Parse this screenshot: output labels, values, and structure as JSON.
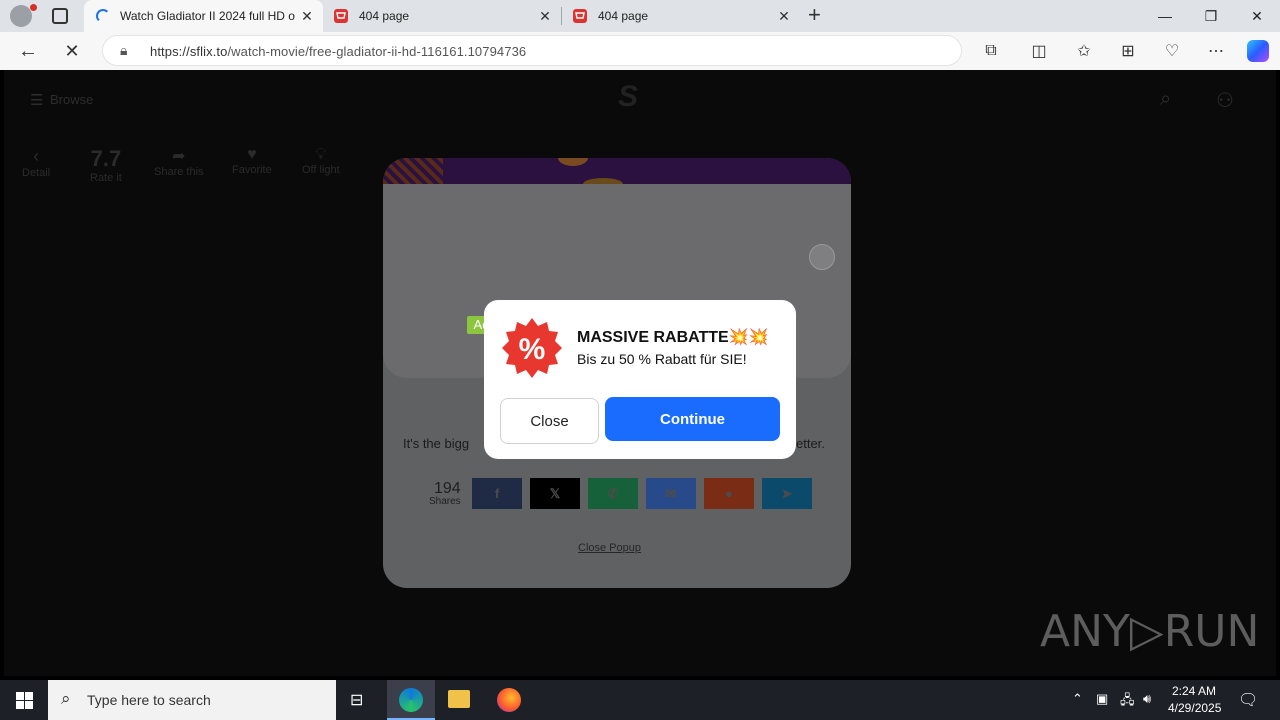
{
  "browser": {
    "tabs": [
      {
        "title": "Watch Gladiator II 2024 full HD on",
        "active": true
      },
      {
        "title": "404 page",
        "active": false
      },
      {
        "title": "404 page",
        "active": false
      }
    ],
    "url_host": "https://sflix.to",
    "url_path": "/watch-movie/free-gladiator-ii-hd-116161.10794736"
  },
  "site": {
    "browse_label": "Browse",
    "rating": "7.7",
    "actions": [
      {
        "label": "Detail"
      },
      {
        "label": "Rate it"
      },
      {
        "label": "Share this"
      },
      {
        "label": "Favorite"
      },
      {
        "label": "Off light"
      }
    ]
  },
  "site_popup": {
    "text_left": "It's the bigg",
    "text_right": "etter.",
    "share_count": "194",
    "share_word": "Shares",
    "share_buttons": [
      {
        "name": "facebook",
        "glyph": "f",
        "color": "#3b5998"
      },
      {
        "name": "x",
        "glyph": "𝕏",
        "color": "#000000"
      },
      {
        "name": "whatsapp",
        "glyph": "✆",
        "color": "#25d366"
      },
      {
        "name": "messenger",
        "glyph": "✉",
        "color": "#448aff"
      },
      {
        "name": "reddit",
        "glyph": "●",
        "color": "#ff4500"
      },
      {
        "name": "telegram",
        "glyph": "➤",
        "color": "#0088cc"
      }
    ],
    "close_label": "Close Popup"
  },
  "ad": {
    "badge": "Ad",
    "title": "MASSIVE RABATTE💥💥",
    "subtitle": "Bis zu 50 % Rabatt für SIE!",
    "close_label": "Close",
    "continue_label": "Continue",
    "icon_symbol": "%"
  },
  "watermark": "ANY▷RUN",
  "taskbar": {
    "search_placeholder": "Type here to search",
    "time": "2:24 AM",
    "date": "4/29/2025"
  }
}
